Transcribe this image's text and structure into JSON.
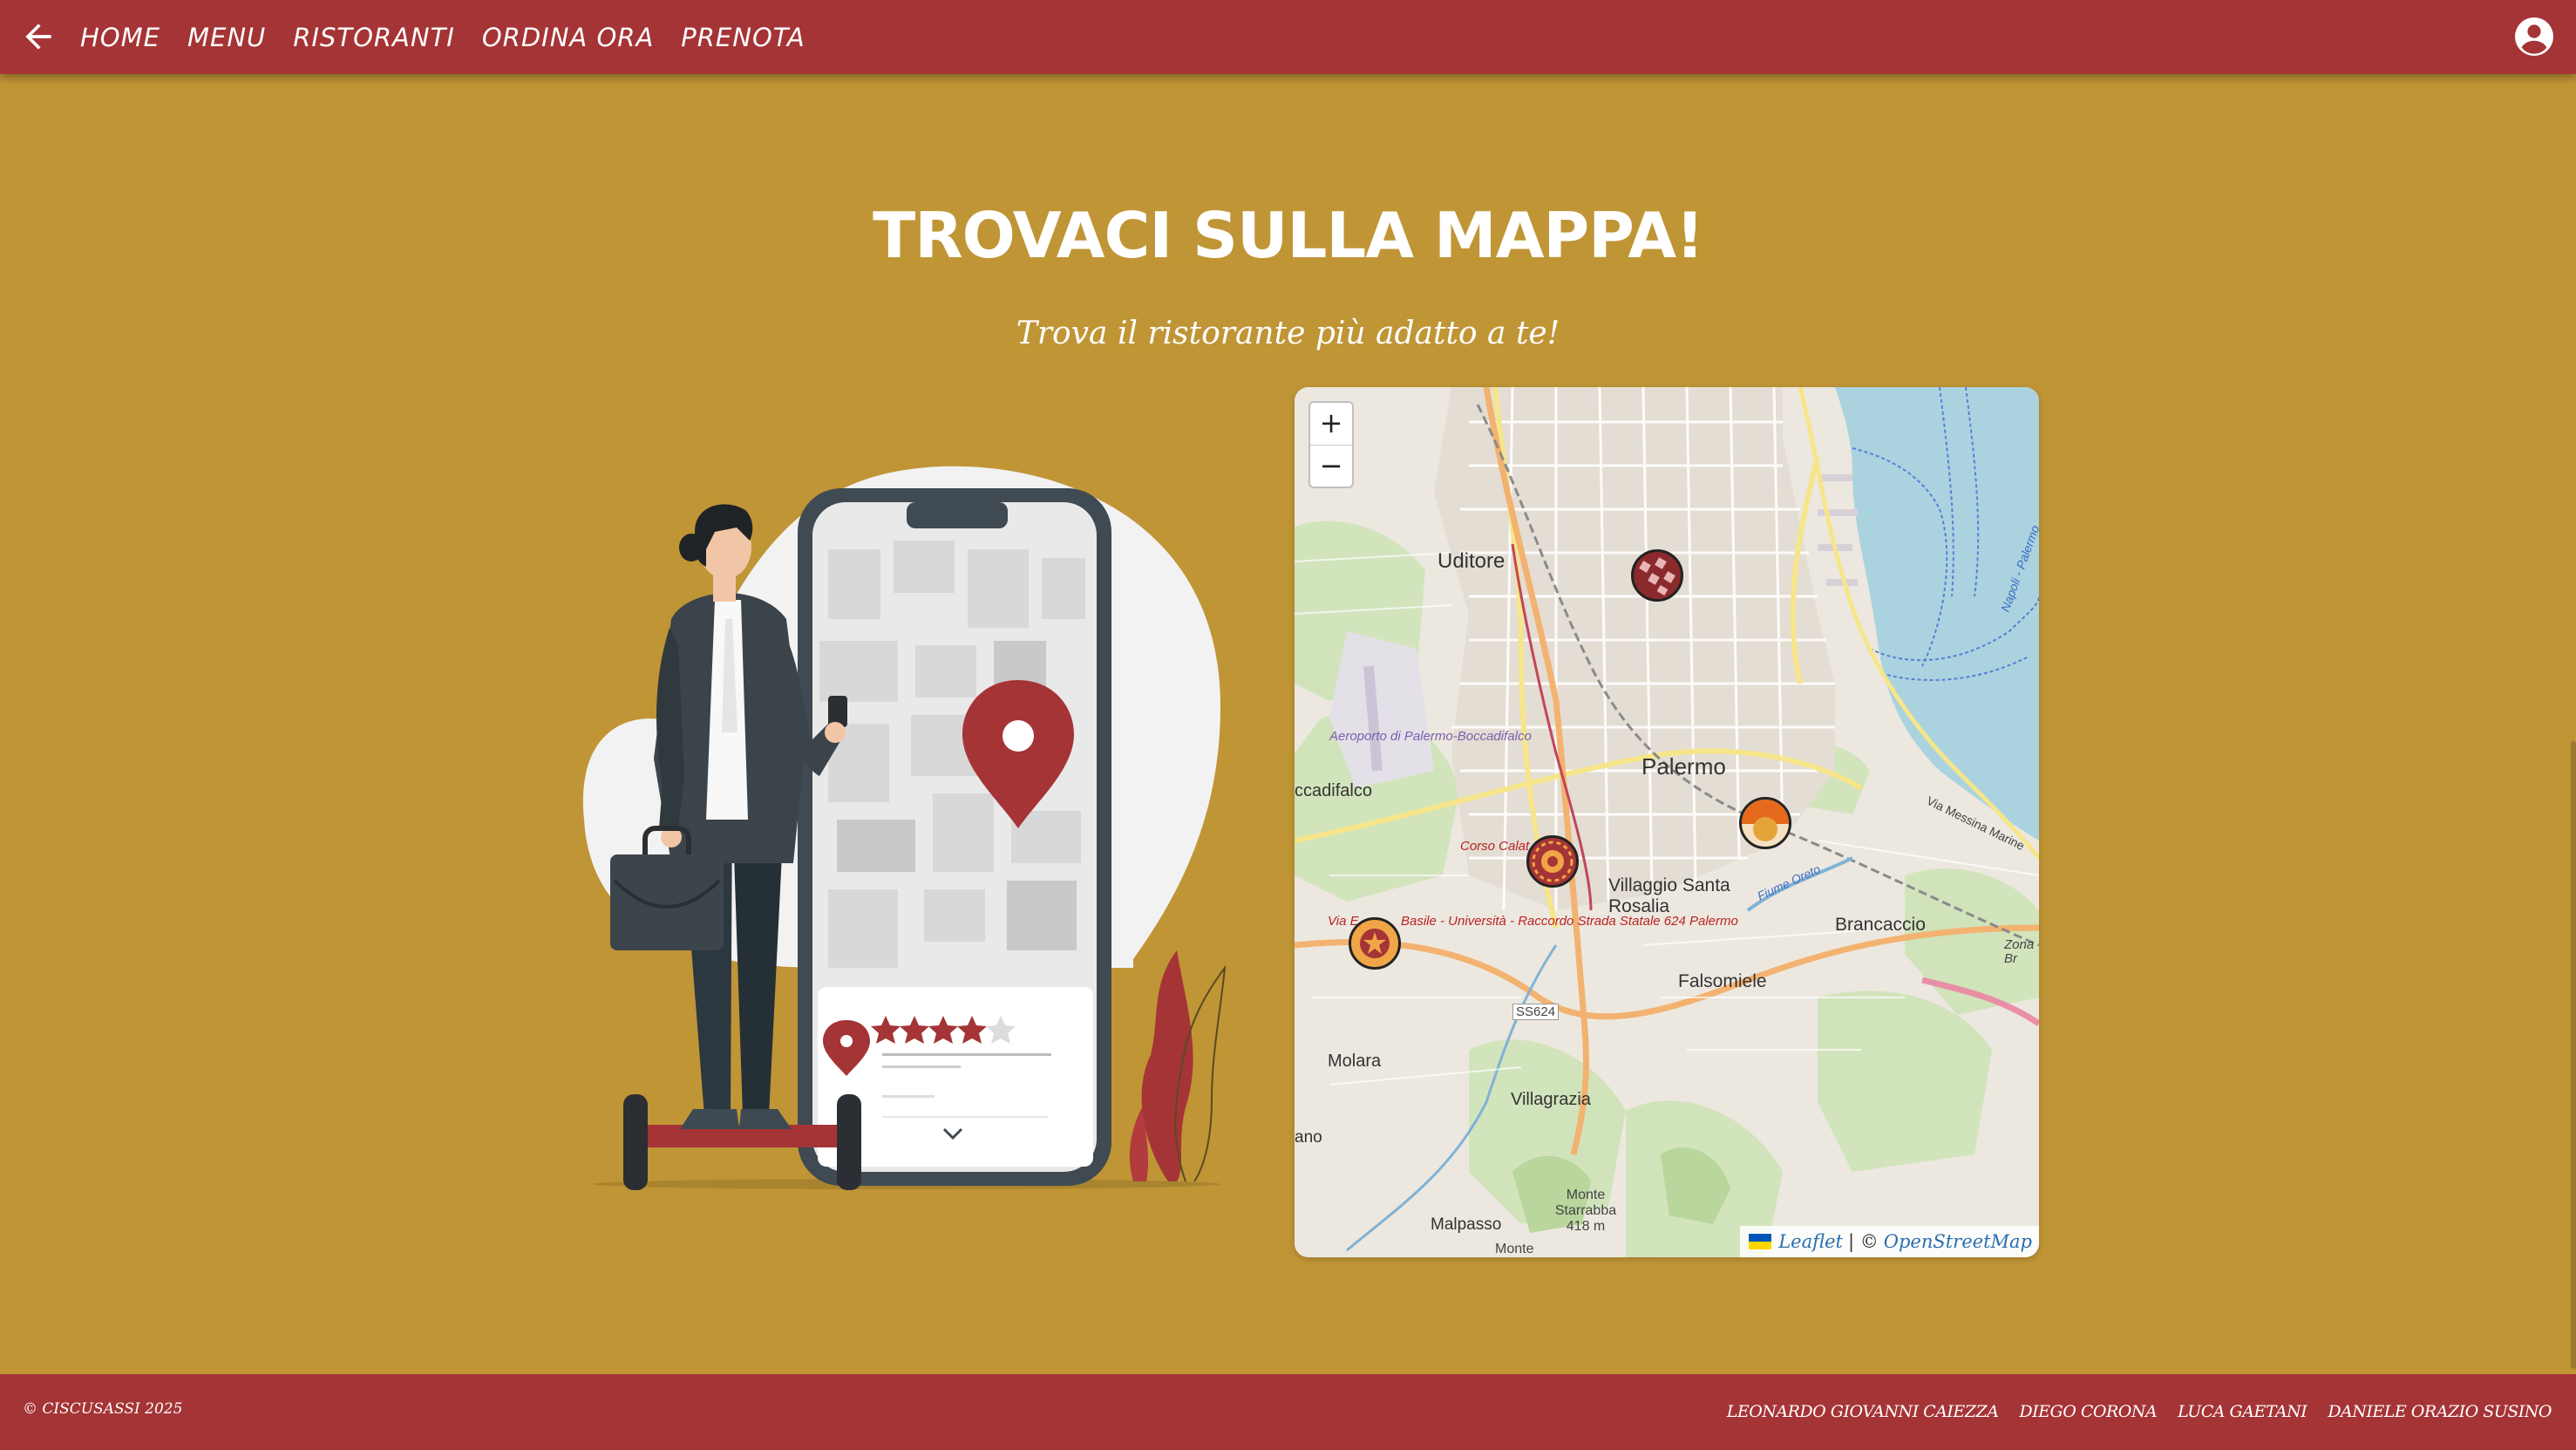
{
  "nav": {
    "links": [
      {
        "label": "HOME"
      },
      {
        "label": "MENU"
      },
      {
        "label": "RISTORANTI"
      },
      {
        "label": "ORDINA ORA"
      },
      {
        "label": "PRENOTA"
      }
    ],
    "back_icon": "arrow-left-icon",
    "account_icon": "account-circle-icon"
  },
  "main": {
    "title": "TROVACI SULLA MAPPA!",
    "subtitle": "Trova il ristorante più adatto a te!"
  },
  "map": {
    "zoom_in": "+",
    "zoom_out": "−",
    "labels": {
      "uditore": "Uditore",
      "palermo": "Palermo",
      "airport": "Aeroporto di Palermo-Boccadifalco",
      "boccadifalco": "ccadifalco",
      "corso": "Corso Calat",
      "villaggio": "Villaggio Santa Rosalia",
      "brancaccio": "Brancaccio",
      "falsomiele": "Falsomiele",
      "via": "Via E",
      "raccordo": "Basile - Università - Raccordo Strada Statale 624 Palermo",
      "ss624": "SS624",
      "molara": "Molara",
      "villagrazia": "Villagrazia",
      "monte": "Monte Starrabba 418 m",
      "malpasso": "Malpasso",
      "monte2": "Monte",
      "ano": "ano",
      "zona": "Zona Br",
      "fiume": "Fiume Oreto",
      "messina": "Via Messina Marine",
      "napoli": "Napoli - Palermo"
    },
    "attribution": {
      "leaflet": "Leaflet",
      "separator": "| ©",
      "osm": "OpenStreetMap"
    }
  },
  "footer": {
    "copyright": "© CISCUSASSI 2025",
    "authors": [
      "LEONARDO GIOVANNI CAIEZZA",
      "DIEGO CORONA",
      "LUCA GAETANI",
      "DANIELE ORAZIO SUSINO"
    ]
  },
  "colors": {
    "primary": "#a53436",
    "background": "#c09536",
    "link": "#2a6eaf"
  }
}
